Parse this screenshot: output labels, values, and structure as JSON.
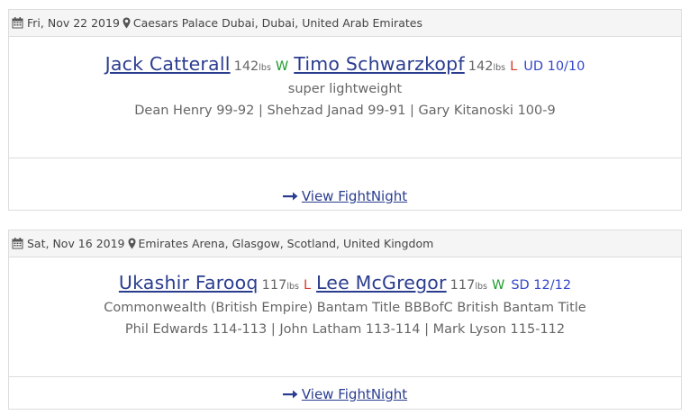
{
  "bouts": [
    {
      "date": "Fri, Nov 22 2019",
      "location": "Caesars Palace Dubai, Dubai, United Arab Emirates",
      "fighter1": {
        "name": "Jack Catterall",
        "weight": "142",
        "unit": "lbs",
        "result": "W"
      },
      "fighter2": {
        "name": "Timo Schwarzkopf",
        "weight": "142",
        "unit": "lbs",
        "result": "L"
      },
      "decision": "UD 10/10",
      "title": "super lightweight",
      "judges": "Dean Henry 99-92 | Shehzad Janad 99-91 | Gary Kitanoski 100-9",
      "link": "View FightNight"
    },
    {
      "date": "Sat, Nov 16 2019",
      "location": "Emirates Arena, Glasgow, Scotland, United Kingdom",
      "fighter1": {
        "name": "Ukashir Farooq",
        "weight": "117",
        "unit": "lbs",
        "result": "L"
      },
      "fighter2": {
        "name": "Lee McGregor",
        "weight": "117",
        "unit": "lbs",
        "result": "W"
      },
      "decision": "SD 12/12",
      "title": "Commonwealth (British Empire) Bantam Title BBBofC British Bantam Title",
      "judges": "Phil Edwards 114-113 | John Latham 113-114 | Mark Lyson 115-112",
      "link": "View FightNight"
    }
  ],
  "icons": {
    "date": "calendar-icon",
    "location": "map-marker-icon",
    "link": "long-arrow-right-icon"
  },
  "colors": {
    "link": "#2b3d8f",
    "win": "#1f9d2e",
    "loss": "#d43a2a",
    "decision": "#3346c9",
    "header_bg": "#f5f5f5",
    "border": "#dddddd"
  }
}
